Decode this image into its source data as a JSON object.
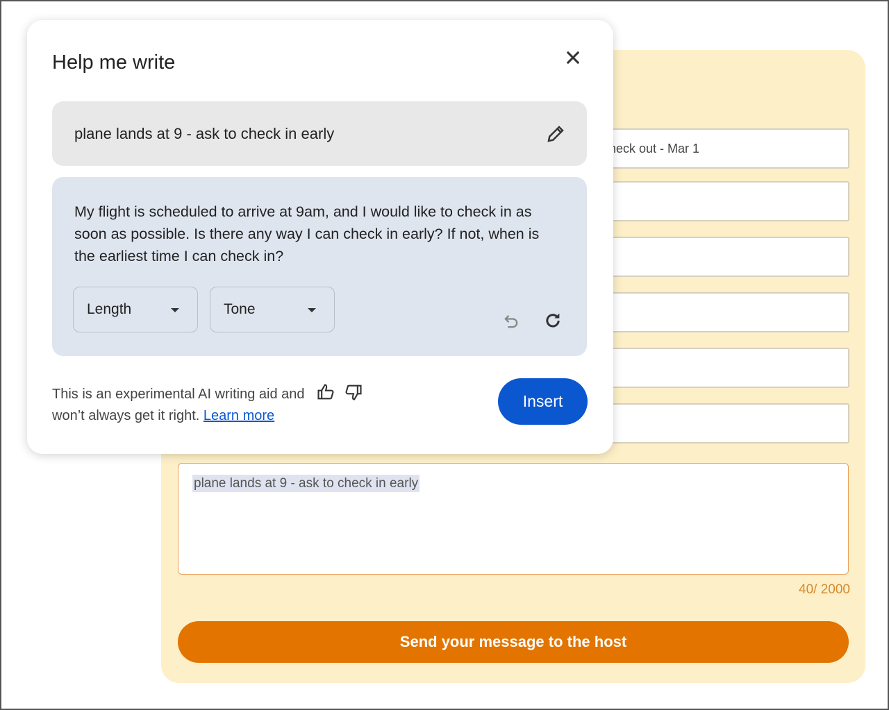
{
  "form": {
    "fields": [
      "check out - Mar 1",
      "",
      "",
      "",
      "",
      ""
    ],
    "message_value": "plane lands at 9 - ask to check in early",
    "counter": "40/ 2000",
    "send_label": "Send your message to the host"
  },
  "dialog": {
    "title": "Help me write",
    "prompt": "plane lands at 9 - ask to check in early",
    "response": "My flight is scheduled to arrive at 9am, and I would like to check in as soon as possible. Is there any way I can check in early? If not, when is the earliest time I can check in?",
    "length_label": "Length",
    "tone_label": "Tone",
    "disclaimer_line1": "This is an experimental AI writing aid and",
    "disclaimer_line2": "won’t always get it right.",
    "learn_more": "Learn more",
    "insert_label": "Insert"
  },
  "colors": {
    "accent": "#0b57d0",
    "send": "#e37400",
    "card": "#fdefc7"
  }
}
